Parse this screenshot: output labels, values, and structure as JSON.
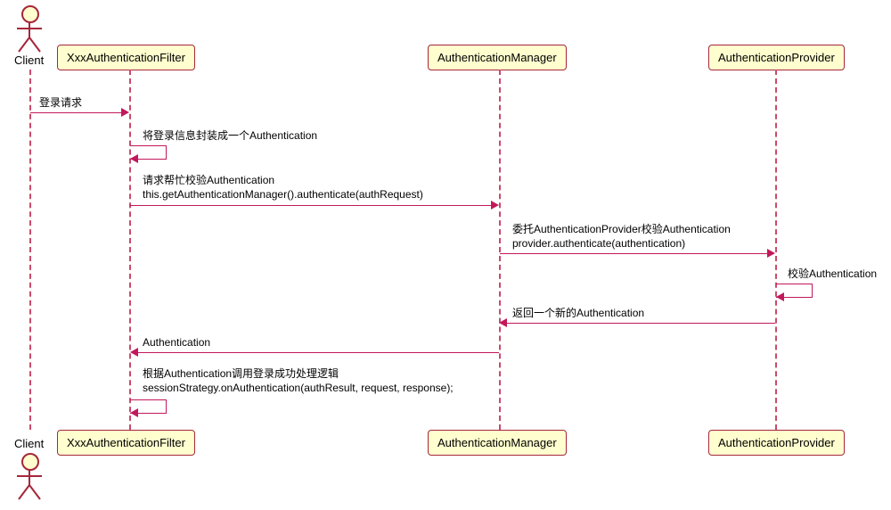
{
  "actor": {
    "name": "Client"
  },
  "participants": [
    {
      "id": "filter",
      "label": "XxxAuthenticationFilter"
    },
    {
      "id": "manager",
      "label": "AuthenticationManager"
    },
    {
      "id": "provider",
      "label": "AuthenticationProvider"
    }
  ],
  "messages": {
    "m1": "登录请求",
    "m2": "将登录信息封装成一个Authentication",
    "m3_line1": "请求帮忙校验Authentication",
    "m3_line2": "this.getAuthenticationManager().authenticate(authRequest)",
    "m4_line1": "委托AuthenticationProvider校验Authentication",
    "m4_line2": "provider.authenticate(authentication)",
    "m5": "校验Authentication",
    "m6": "返回一个新的Authentication",
    "m7": "Authentication",
    "m8_line1": "根据Authentication调用登录成功处理逻辑",
    "m8_line2": "sessionStrategy.onAuthentication(authResult, request, response);"
  }
}
